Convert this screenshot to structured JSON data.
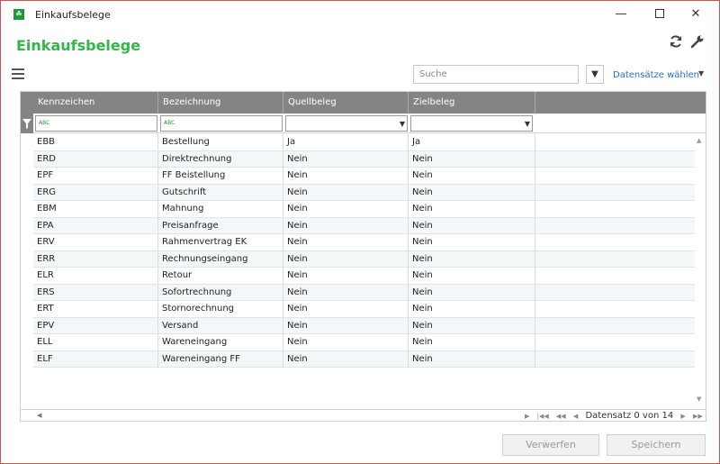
{
  "window": {
    "title": "Einkaufsbelege",
    "app_icon": "app-logo-icon"
  },
  "header": {
    "page_title": "Einkaufsbelege"
  },
  "toolbar": {
    "search_placeholder": "Suche",
    "datasets_label": "Datensätze wählen"
  },
  "grid": {
    "columns": [
      "Kennzeichen",
      "Bezeichnung",
      "Quellbeleg",
      "Zielbeleg"
    ],
    "filter_abc": "ABC",
    "rows": [
      [
        "EBB",
        "Bestellung",
        "Ja",
        "Ja"
      ],
      [
        "ERD",
        "Direktrechnung",
        "Nein",
        "Nein"
      ],
      [
        "EPF",
        "FF Beistellung",
        "Nein",
        "Nein"
      ],
      [
        "ERG",
        "Gutschrift",
        "Nein",
        "Nein"
      ],
      [
        "EBM",
        "Mahnung",
        "Nein",
        "Nein"
      ],
      [
        "EPA",
        "Preisanfrage",
        "Nein",
        "Nein"
      ],
      [
        "ERV",
        "Rahmenvertrag EK",
        "Nein",
        "Nein"
      ],
      [
        "ERR",
        "Rechnungseingang",
        "Nein",
        "Nein"
      ],
      [
        "ELR",
        "Retour",
        "Nein",
        "Nein"
      ],
      [
        "ERS",
        "Sofortrechnung",
        "Nein",
        "Nein"
      ],
      [
        "ERT",
        "Stornorechnung",
        "Nein",
        "Nein"
      ],
      [
        "EPV",
        "Versand",
        "Nein",
        "Nein"
      ],
      [
        "ELL",
        "Wareneingang",
        "Nein",
        "Nein"
      ],
      [
        "ELF",
        "Wareneingang FF",
        "Nein",
        "Nein"
      ]
    ],
    "pager_text": "Datensatz 0 von 14"
  },
  "buttons": {
    "discard": "Verwerfen",
    "save": "Speichern"
  },
  "colors": {
    "title_green": "#37b44a",
    "header_gray": "#848484",
    "link_blue": "#2a6ebb",
    "border_red": "#c9575a"
  }
}
